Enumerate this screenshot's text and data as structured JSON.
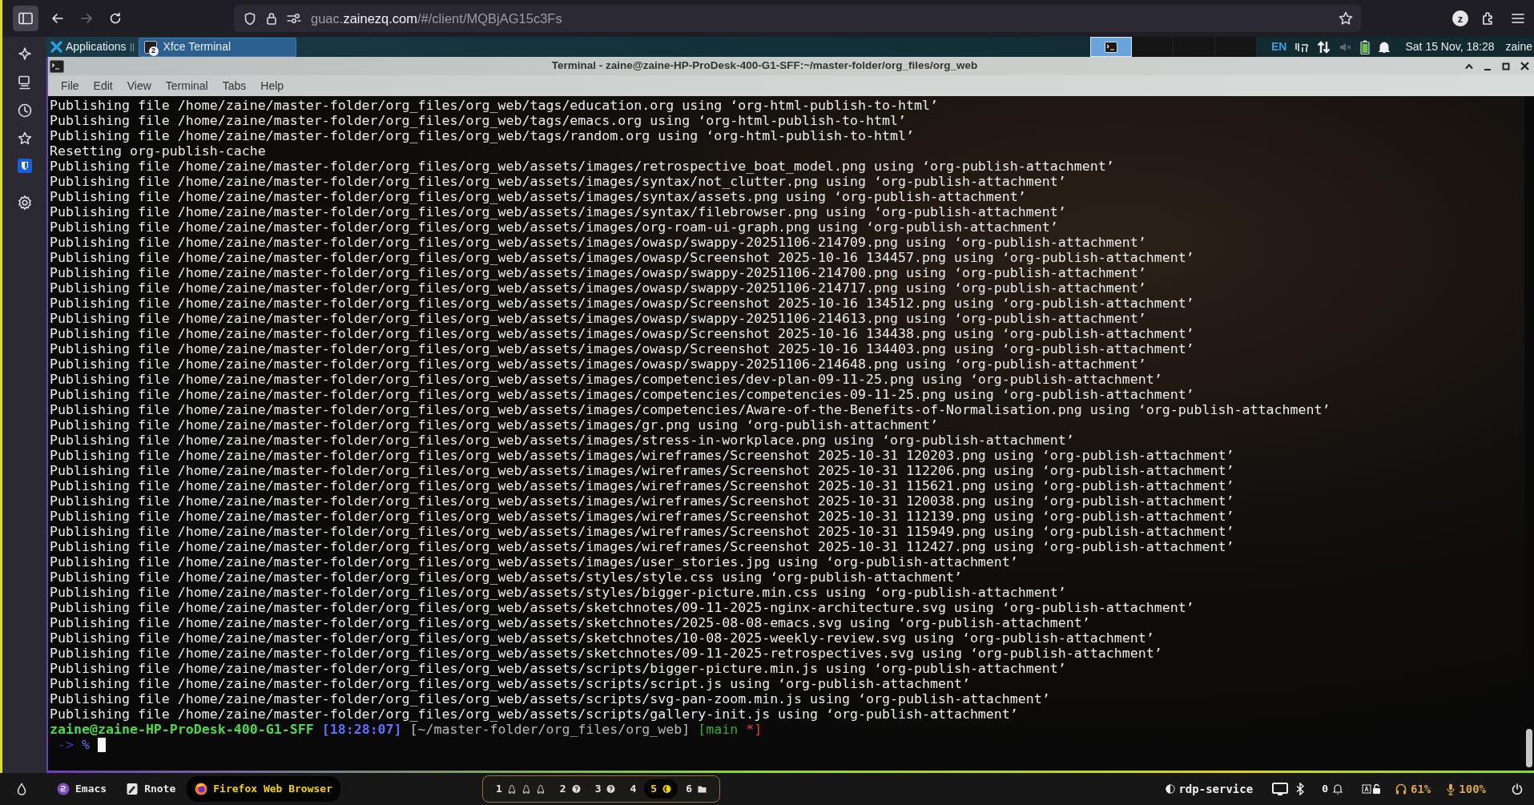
{
  "browser": {
    "back_disabled": false,
    "forward_disabled": true,
    "url": {
      "prefix": "guac.",
      "domain": "zainezq.com",
      "path": "/#/client/MQBjAG15c3Fs"
    },
    "profile_initial": "z"
  },
  "xfce_panel": {
    "applications_label": "Applications",
    "tasks": [
      {
        "label": "Xfce Terminal",
        "badge": "2",
        "selected": true
      }
    ],
    "workspaces": [
      {
        "selected": true
      },
      {
        "selected": false
      },
      {
        "selected": false
      },
      {
        "selected": false
      }
    ],
    "keyboard_layout": "EN",
    "clock": "Sat 15 Nov, 18:28",
    "user": "zaine"
  },
  "terminal": {
    "title": "Terminal - zaine@zaine-HP-ProDesk-400-G1-SFF:~/master-folder/org_files/org_web",
    "menu": [
      "File",
      "Edit",
      "View",
      "Terminal",
      "Tabs",
      "Help"
    ],
    "lines": [
      "Publishing file /home/zaine/master-folder/org_files/org_web/tags/education.org using ‘org-html-publish-to-html’",
      "Publishing file /home/zaine/master-folder/org_files/org_web/tags/emacs.org using ‘org-html-publish-to-html’",
      "Publishing file /home/zaine/master-folder/org_files/org_web/tags/random.org using ‘org-html-publish-to-html’",
      "Resetting org-publish-cache",
      "Publishing file /home/zaine/master-folder/org_files/org_web/assets/images/retrospective_boat_model.png using ‘org-publish-attachment’",
      "Publishing file /home/zaine/master-folder/org_files/org_web/assets/images/syntax/not_clutter.png using ‘org-publish-attachment’",
      "Publishing file /home/zaine/master-folder/org_files/org_web/assets/images/syntax/assets.png using ‘org-publish-attachment’",
      "Publishing file /home/zaine/master-folder/org_files/org_web/assets/images/syntax/filebrowser.png using ‘org-publish-attachment’",
      "Publishing file /home/zaine/master-folder/org_files/org_web/assets/images/org-roam-ui-graph.png using ‘org-publish-attachment’",
      "Publishing file /home/zaine/master-folder/org_files/org_web/assets/images/owasp/swappy-20251106-214709.png using ‘org-publish-attachment’",
      "Publishing file /home/zaine/master-folder/org_files/org_web/assets/images/owasp/Screenshot 2025-10-16 134457.png using ‘org-publish-attachment’",
      "Publishing file /home/zaine/master-folder/org_files/org_web/assets/images/owasp/swappy-20251106-214700.png using ‘org-publish-attachment’",
      "Publishing file /home/zaine/master-folder/org_files/org_web/assets/images/owasp/swappy-20251106-214717.png using ‘org-publish-attachment’",
      "Publishing file /home/zaine/master-folder/org_files/org_web/assets/images/owasp/Screenshot 2025-10-16 134512.png using ‘org-publish-attachment’",
      "Publishing file /home/zaine/master-folder/org_files/org_web/assets/images/owasp/swappy-20251106-214613.png using ‘org-publish-attachment’",
      "Publishing file /home/zaine/master-folder/org_files/org_web/assets/images/owasp/Screenshot 2025-10-16 134438.png using ‘org-publish-attachment’",
      "Publishing file /home/zaine/master-folder/org_files/org_web/assets/images/owasp/Screenshot 2025-10-16 134403.png using ‘org-publish-attachment’",
      "Publishing file /home/zaine/master-folder/org_files/org_web/assets/images/owasp/swappy-20251106-214648.png using ‘org-publish-attachment’",
      "Publishing file /home/zaine/master-folder/org_files/org_web/assets/images/competencies/dev-plan-09-11-25.png using ‘org-publish-attachment’",
      "Publishing file /home/zaine/master-folder/org_files/org_web/assets/images/competencies/competencies-09-11-25.png using ‘org-publish-attachment’",
      "Publishing file /home/zaine/master-folder/org_files/org_web/assets/images/competencies/Aware-of-the-Benefits-of-Normalisation.png using ‘org-publish-attachment’",
      "Publishing file /home/zaine/master-folder/org_files/org_web/assets/images/gr.png using ‘org-publish-attachment’",
      "Publishing file /home/zaine/master-folder/org_files/org_web/assets/images/stress-in-workplace.png using ‘org-publish-attachment’",
      "Publishing file /home/zaine/master-folder/org_files/org_web/assets/images/wireframes/Screenshot 2025-10-31 120203.png using ‘org-publish-attachment’",
      "Publishing file /home/zaine/master-folder/org_files/org_web/assets/images/wireframes/Screenshot 2025-10-31 112206.png using ‘org-publish-attachment’",
      "Publishing file /home/zaine/master-folder/org_files/org_web/assets/images/wireframes/Screenshot 2025-10-31 115621.png using ‘org-publish-attachment’",
      "Publishing file /home/zaine/master-folder/org_files/org_web/assets/images/wireframes/Screenshot 2025-10-31 120038.png using ‘org-publish-attachment’",
      "Publishing file /home/zaine/master-folder/org_files/org_web/assets/images/wireframes/Screenshot 2025-10-31 112139.png using ‘org-publish-attachment’",
      "Publishing file /home/zaine/master-folder/org_files/org_web/assets/images/wireframes/Screenshot 2025-10-31 115949.png using ‘org-publish-attachment’",
      "Publishing file /home/zaine/master-folder/org_files/org_web/assets/images/wireframes/Screenshot 2025-10-31 112427.png using ‘org-publish-attachment’",
      "Publishing file /home/zaine/master-folder/org_files/org_web/assets/images/user_stories.jpg using ‘org-publish-attachment’",
      "Publishing file /home/zaine/master-folder/org_files/org_web/assets/styles/style.css using ‘org-publish-attachment’",
      "Publishing file /home/zaine/master-folder/org_files/org_web/assets/styles/bigger-picture.min.css using ‘org-publish-attachment’",
      "Publishing file /home/zaine/master-folder/org_files/org_web/assets/sketchnotes/09-11-2025-nginx-architecture.svg using ‘org-publish-attachment’",
      "Publishing file /home/zaine/master-folder/org_files/org_web/assets/sketchnotes/2025-08-08-emacs.svg using ‘org-publish-attachment’",
      "Publishing file /home/zaine/master-folder/org_files/org_web/assets/sketchnotes/10-08-2025-weekly-review.svg using ‘org-publish-attachment’",
      "Publishing file /home/zaine/master-folder/org_files/org_web/assets/sketchnotes/09-11-2025-retrospectives.svg using ‘org-publish-attachment’",
      "Publishing file /home/zaine/master-folder/org_files/org_web/assets/scripts/bigger-picture.min.js using ‘org-publish-attachment’",
      "Publishing file /home/zaine/master-folder/org_files/org_web/assets/scripts/script.js using ‘org-publish-attachment’",
      "Publishing file /home/zaine/master-folder/org_files/org_web/assets/scripts/svg-pan-zoom.min.js using ‘org-publish-attachment’",
      "Publishing file /home/zaine/master-folder/org_files/org_web/assets/scripts/gallery-init.js using ‘org-publish-attachment’"
    ],
    "prompt": [
      {
        "text": "zaine@zaine-HP-ProDesk-400-G1-SFF",
        "color": "#4cd84c"
      },
      {
        "text": "[18:28:07]",
        "color": "#5f6fff"
      },
      {
        "text": "[~/master-folder/org_files/org_web]",
        "color": "#b8b8b8"
      },
      {
        "text": "[main",
        "color": "#2fae2f"
      },
      {
        "text": "*]",
        "color": "#e04040"
      }
    ],
    "input_prompt": [
      {
        "text": "->",
        "color": "#3a3ad6"
      },
      {
        "text": "%",
        "color": "#6a6af0"
      }
    ]
  },
  "bottom_bar": {
    "apps": [
      {
        "label": "Emacs",
        "selected": false
      },
      {
        "label": "Rnote",
        "selected": false
      },
      {
        "label": "Firefox Web Browser",
        "selected": true
      }
    ],
    "workspaces": [
      {
        "label": "1",
        "selected": false
      },
      {
        "label": "2",
        "selected": false
      },
      {
        "label": "3",
        "selected": false
      },
      {
        "label": "4",
        "selected": false
      },
      {
        "label": "5",
        "selected": true
      },
      {
        "label": "6",
        "selected": false
      }
    ],
    "service": "rdp-service",
    "notification_count": "0",
    "headphone_volume": "61%",
    "mic_volume": "100%"
  }
}
